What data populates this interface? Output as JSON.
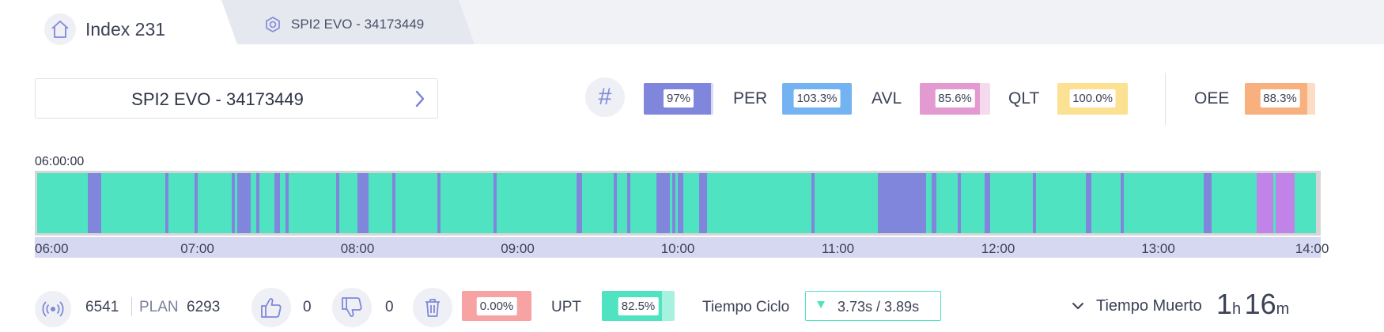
{
  "tabs": {
    "home": {
      "title": "Index 231",
      "icon": "home-icon"
    },
    "second": {
      "label": "SPI2 EVO - 34173449",
      "icon": "hexagon-nut-icon"
    }
  },
  "machine": {
    "name": "SPI2 EVO - 34173449",
    "icon": "chevron-right-icon"
  },
  "kpis": {
    "hash_icon": "#",
    "items": [
      {
        "id": "count",
        "label": "",
        "value": "97%",
        "fill": 0.97,
        "color": "#8186dd",
        "track": "#d9dbf5"
      },
      {
        "id": "per",
        "label": "PER",
        "value": "103.3%",
        "fill": 1.0,
        "color": "#74b3f2",
        "track": "#cfe3fb"
      },
      {
        "id": "avl",
        "label": "AVL",
        "value": "85.6%",
        "fill": 0.856,
        "color": "#e39ad0",
        "track": "#f5d9ec"
      },
      {
        "id": "qlt",
        "label": "QLT",
        "value": "100.0%",
        "fill": 1.0,
        "color": "#fbe191",
        "track": "#fdf0c9"
      },
      {
        "id": "oee",
        "label": "OEE",
        "value": "88.3%",
        "fill": 0.883,
        "color": "#f8b07f",
        "track": "#fbdcc5"
      }
    ]
  },
  "timeline": {
    "start_label": "06:00:00",
    "start": "06:00",
    "end": "14:00",
    "now": "13:59",
    "running_color": "#4fe3c1",
    "stop_color": "#8186dd",
    "alt_color": "#c283e8",
    "stops": [
      [
        "06:19",
        "06:24"
      ],
      [
        "06:48",
        "06:49"
      ],
      [
        "06:59",
        "07:00"
      ],
      [
        "07:13",
        "07:14"
      ],
      [
        "07:15",
        "07:20"
      ],
      [
        "07:22",
        "07:23"
      ],
      [
        "07:29",
        "07:31"
      ],
      [
        "07:33",
        "07:34"
      ],
      [
        "07:52",
        "07:53"
      ],
      [
        "08:00",
        "08:04"
      ],
      [
        "08:13",
        "08:14"
      ],
      [
        "08:30",
        "08:31"
      ],
      [
        "08:51",
        "08:52"
      ],
      [
        "09:22",
        "09:24"
      ],
      [
        "09:36",
        "09:37"
      ],
      [
        "09:41",
        "09:42"
      ],
      [
        "09:52",
        "09:57"
      ],
      [
        "09:58",
        "09:59"
      ],
      [
        "10:00",
        "10:02"
      ],
      [
        "10:08",
        "10:11"
      ],
      [
        "10:50",
        "10:51"
      ],
      [
        "11:15",
        "11:33"
      ],
      [
        "11:35",
        "11:37"
      ],
      [
        "11:45",
        "11:46"
      ],
      [
        "11:55",
        "11:57"
      ],
      [
        "12:13",
        "12:14"
      ],
      [
        "12:33",
        "12:35"
      ],
      [
        "12:46",
        "12:47"
      ],
      [
        "13:17",
        "13:20"
      ]
    ],
    "alt_stops": [
      [
        "13:37",
        "13:43"
      ],
      [
        "13:44",
        "13:51"
      ]
    ],
    "ticks": [
      "06:00",
      "07:00",
      "08:00",
      "09:00",
      "10:00",
      "11:00",
      "12:00",
      "13:00",
      "14:00"
    ]
  },
  "bottom": {
    "antenna_icon": "antenna-icon",
    "produced": "6541",
    "plan_label": "PLAN",
    "plan_value": "6293",
    "good_icon": "thumbs-up-icon",
    "good_count": "0",
    "bad_icon": "thumbs-down-icon",
    "bad_count": "0",
    "trash_icon": "trash-icon",
    "scrap_pct": "0.00%",
    "scrap_color": "#f8a3a3",
    "upt_label": "UPT",
    "upt_value": "82.5%",
    "upt_fill": 0.825,
    "upt_color": "#4fe3c1",
    "upt_track": "#a7f1df",
    "cycle_label": "Tiempo Ciclo",
    "cycle_value": "3.73s  /  3.89s",
    "dead_label": "Tiempo Muerto",
    "dead_hours": "1",
    "dead_hours_unit": "h",
    "dead_minutes": "16",
    "dead_minutes_unit": "m"
  }
}
